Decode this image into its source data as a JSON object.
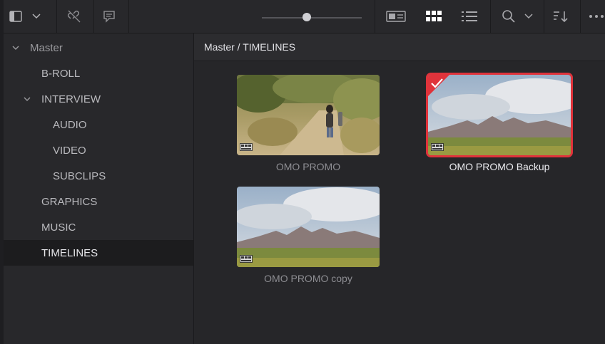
{
  "toolbar": {
    "icons": [
      "sidebar-toggle-icon",
      "chevron-down-icon",
      "link-off-icon",
      "comment-icon",
      "zoom-slider",
      "metadata-view-icon",
      "grid-view-icon",
      "list-view-icon",
      "search-icon",
      "chevron-down-icon",
      "sort-icon",
      "more-icon"
    ],
    "zoom_level": 0.45
  },
  "sidebar": {
    "items": [
      {
        "label": "Master",
        "level": 0,
        "expanded": true
      },
      {
        "label": "B-ROLL",
        "level": 1
      },
      {
        "label": "INTERVIEW",
        "level": 1,
        "expanded": true
      },
      {
        "label": "AUDIO",
        "level": 2
      },
      {
        "label": "VIDEO",
        "level": 2
      },
      {
        "label": "SUBCLIPS",
        "level": 2
      },
      {
        "label": "GRAPHICS",
        "level": 1
      },
      {
        "label": "MUSIC",
        "level": 1
      },
      {
        "label": "TIMELINES",
        "level": 1,
        "selected": true
      }
    ]
  },
  "main": {
    "breadcrumb": "Master / TIMELINES",
    "clips": [
      {
        "name": "OMO PROMO",
        "selected": false
      },
      {
        "name": "OMO PROMO Backup",
        "selected": true
      },
      {
        "name": "OMO PROMO copy",
        "selected": false
      }
    ]
  },
  "colors": {
    "selection_red": "#e0333b",
    "background": "#28282b"
  }
}
